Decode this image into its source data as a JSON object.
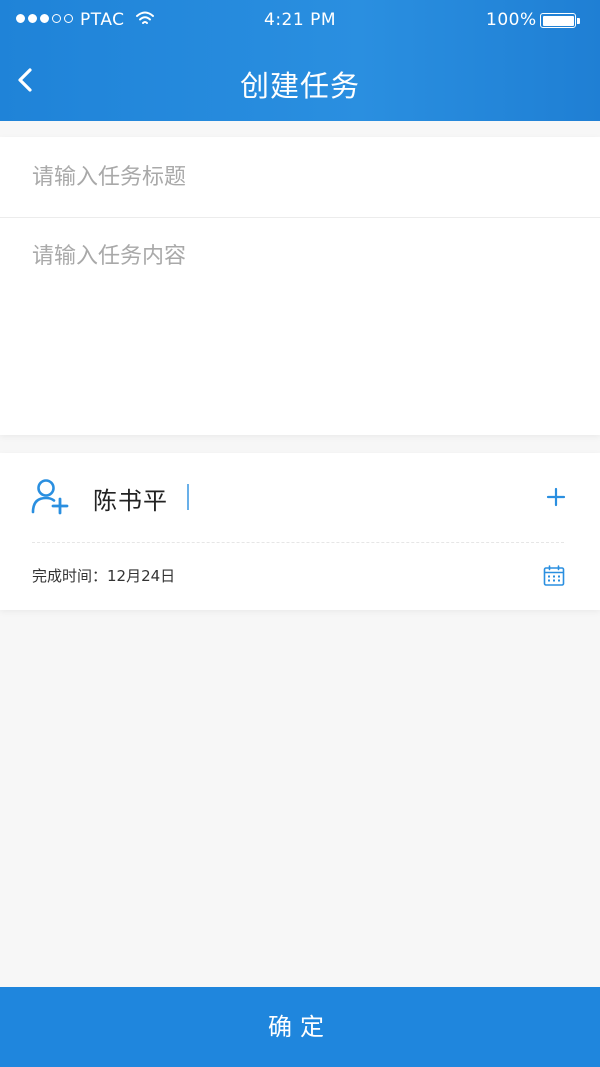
{
  "status_bar": {
    "carrier": "PTAC",
    "time": "4:21 PM",
    "battery": "100%",
    "signal_filled": 3,
    "signal_total": 5
  },
  "nav": {
    "title": "创建任务",
    "back_icon": "chevron-left-icon"
  },
  "task_form": {
    "title_placeholder": "请输入任务标题",
    "title_value": "",
    "content_placeholder": "请输入任务内容",
    "content_value": ""
  },
  "assignee": {
    "icon": "person-add-icon",
    "name": "陈书平",
    "add_icon": "plus-icon"
  },
  "due": {
    "label": "完成时间：12月24日",
    "icon": "calendar-icon"
  },
  "footer": {
    "confirm_label": "确定"
  },
  "colors": {
    "primary": "#2a8fe0",
    "header": "#1f83d8",
    "background": "#f7f7f7"
  }
}
